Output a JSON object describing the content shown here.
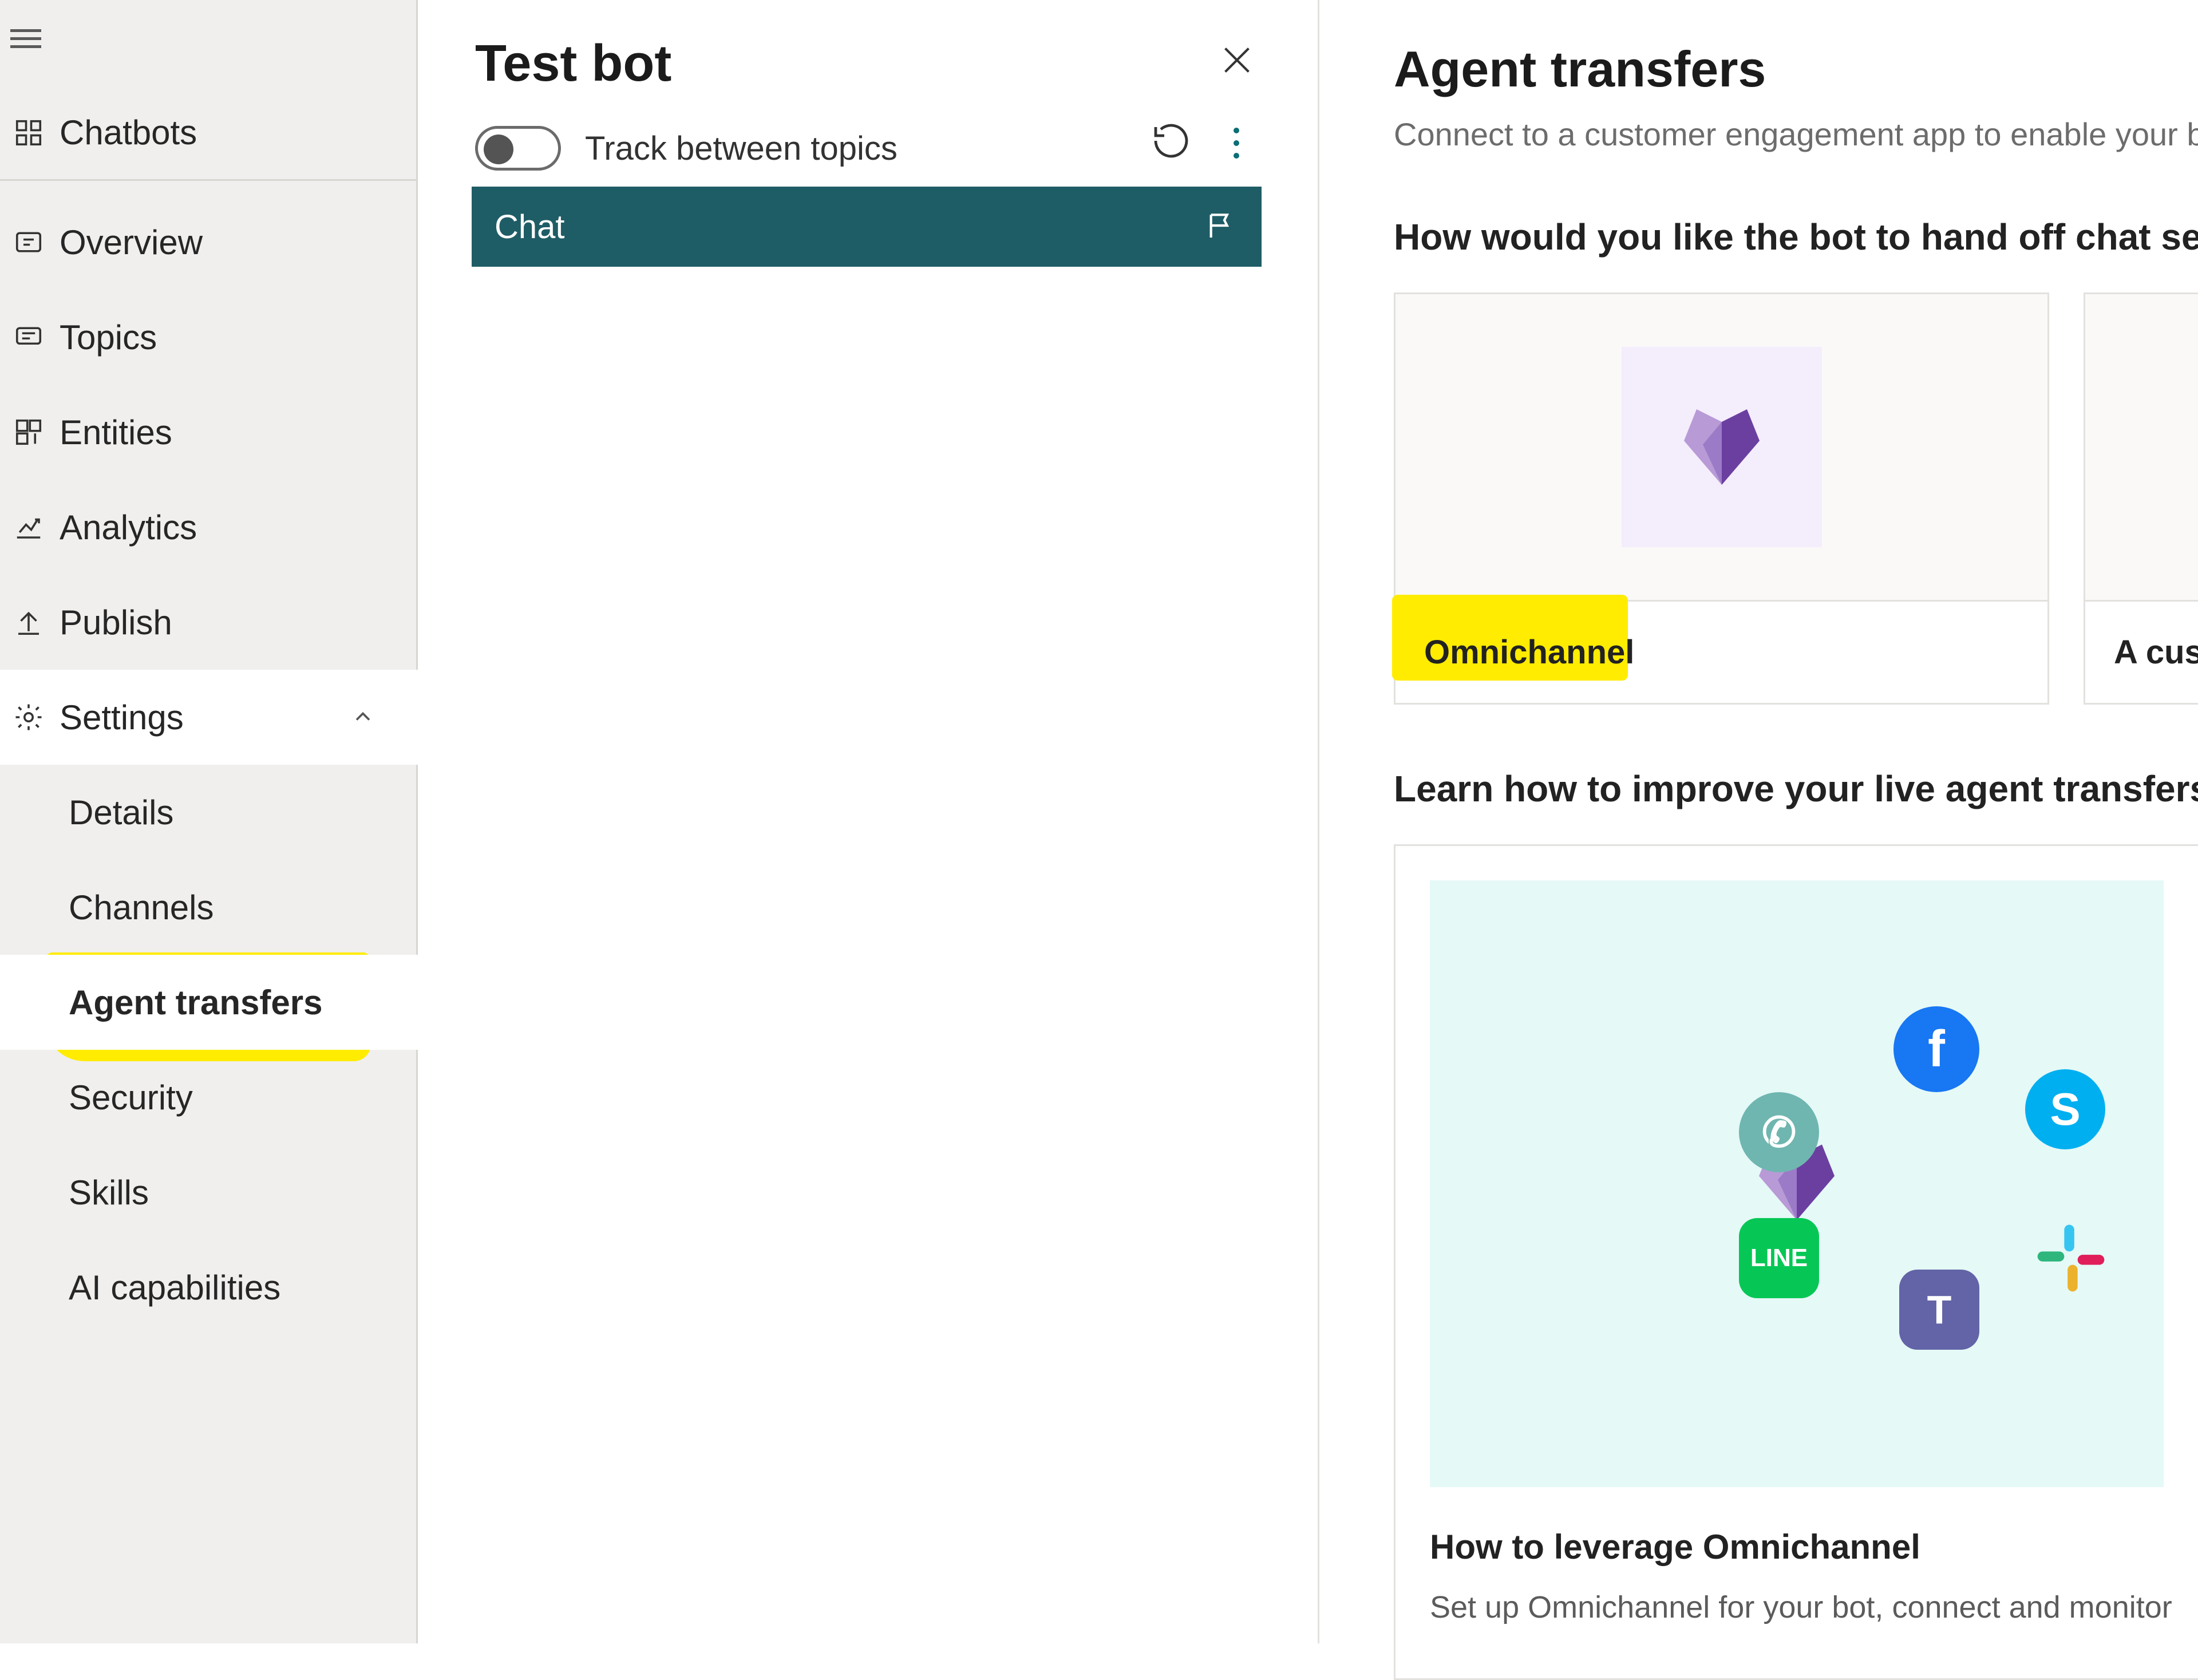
{
  "nav": {
    "chatbots": "Chatbots",
    "items": [
      "Overview",
      "Topics",
      "Entities",
      "Analytics",
      "Publish"
    ],
    "settings_label": "Settings",
    "settings_expanded": true,
    "sub": [
      "Details",
      "Channels",
      "Agent transfers",
      "Security",
      "Skills",
      "AI capabilities"
    ],
    "active_sub_index": 2
  },
  "testbot": {
    "title": "Test bot",
    "track_label": "Track between topics",
    "track_on": false,
    "chat_header": "Chat"
  },
  "content": {
    "title": "Agent transfers",
    "subtitle": "Connect to a customer engagement app to enable your b",
    "handoff_heading": "How would you like the bot to hand off chat sessio",
    "card1_label": "Omnichannel",
    "card2_label": "A cus",
    "learn_heading": "Learn how to improve your live agent transfers",
    "learn_card_title": "How to leverage Omnichannel",
    "learn_card_desc": "Set up Omnichannel for your bot, connect and monitor"
  },
  "colors": {
    "nav_bg": "#f0efed",
    "chat_hdr": "#1f5d66",
    "highlight": "#ffec00",
    "card_bg": "#faf9f8",
    "service_logo_bg": "#f4edfc",
    "learn_bg": "#e5f9f7"
  }
}
